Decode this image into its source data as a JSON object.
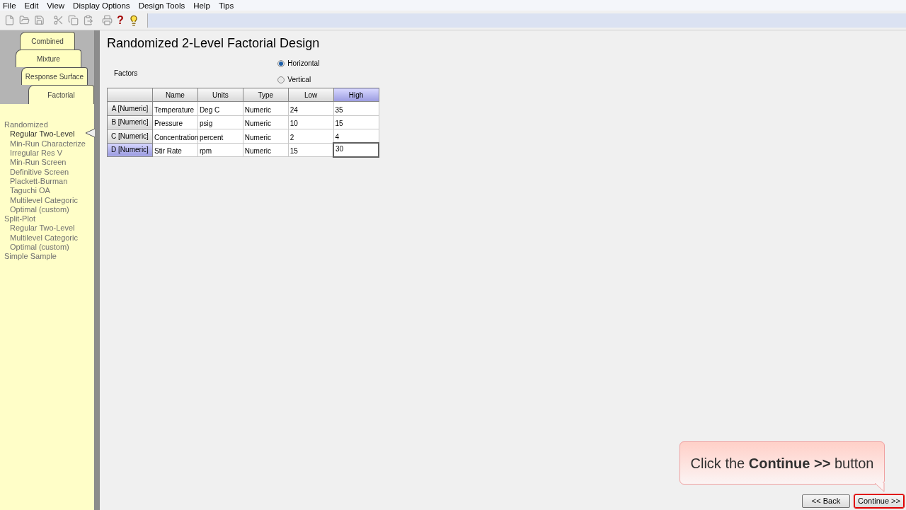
{
  "menu_bar": [
    "File",
    "Edit",
    "View",
    "Display Options",
    "Design Tools",
    "Help",
    "Tips"
  ],
  "toolbar": {
    "help_glyph": "?"
  },
  "sidebar": {
    "tabs": [
      {
        "label": "Combined",
        "selected": false
      },
      {
        "label": "Mixture",
        "selected": false
      },
      {
        "label": "Response Surface",
        "selected": false
      },
      {
        "label": "Factorial",
        "selected": true
      }
    ],
    "tree": [
      {
        "label": "Randomized",
        "selected": false,
        "children": [
          {
            "label": "Regular Two-Level",
            "selected": true
          },
          {
            "label": "Min-Run Characterize",
            "selected": false
          },
          {
            "label": "Irregular Res V",
            "selected": false
          },
          {
            "label": "Min-Run Screen",
            "selected": false
          },
          {
            "label": "Definitive Screen",
            "selected": false
          },
          {
            "label": "Plackett-Burman",
            "selected": false
          },
          {
            "label": "Taguchi OA",
            "selected": false
          },
          {
            "label": "Multilevel Categoric",
            "selected": false
          },
          {
            "label": "Optimal (custom)",
            "selected": false
          }
        ]
      },
      {
        "label": "Split-Plot",
        "selected": false,
        "children": [
          {
            "label": "Regular Two-Level",
            "selected": false
          },
          {
            "label": "Multilevel Categoric",
            "selected": false
          },
          {
            "label": "Optimal (custom)",
            "selected": false
          }
        ]
      },
      {
        "label": "Simple Sample",
        "selected": false
      }
    ]
  },
  "title": "Randomized 2-Level Factorial Design",
  "factors_label": "Factors",
  "orientation": [
    {
      "label": "Horizontal",
      "selected": true
    },
    {
      "label": "Vertical",
      "selected": false
    }
  ],
  "table": {
    "columns": [
      {
        "label": "Name",
        "selected": false
      },
      {
        "label": "Units",
        "selected": false
      },
      {
        "label": "Type",
        "selected": false
      },
      {
        "label": "Low",
        "selected": false
      },
      {
        "label": "High",
        "selected": true
      }
    ],
    "rows": [
      {
        "header": "A [Numeric]",
        "selected": false,
        "cells": [
          "Temperature",
          "Deg C",
          "Numeric",
          "24",
          "35"
        ]
      },
      {
        "header": "B [Numeric]",
        "selected": false,
        "cells": [
          "Pressure",
          "psig",
          "Numeric",
          "10",
          "15"
        ]
      },
      {
        "header": "C [Numeric]",
        "selected": false,
        "cells": [
          "Concentration",
          "percent",
          "Numeric",
          "2",
          "4"
        ]
      },
      {
        "header": "D [Numeric]",
        "selected": true,
        "cells": [
          "Stir Rate",
          "rpm",
          "Numeric",
          "15",
          "30"
        ]
      }
    ]
  },
  "callout": "Click the **Continue >>** button",
  "buttons": [
    {
      "label": "<< Back",
      "highlighted": false
    },
    {
      "label": "Continue >>",
      "highlighted": true
    }
  ]
}
